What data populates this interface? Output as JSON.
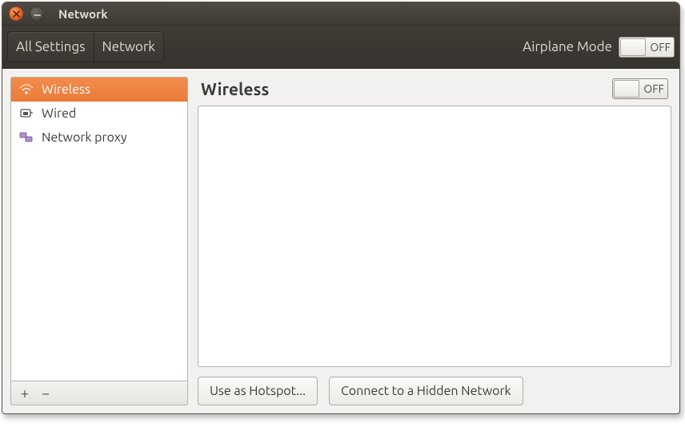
{
  "window": {
    "title": "Network"
  },
  "toolbar": {
    "all_settings": "All Settings",
    "network": "Network",
    "airplane_label": "Airplane Mode",
    "airplane_state": "OFF"
  },
  "sidebar": {
    "items": [
      {
        "label": "Wireless",
        "selected": true
      },
      {
        "label": "Wired"
      },
      {
        "label": "Network proxy"
      }
    ],
    "add": "+",
    "remove": "−"
  },
  "panel": {
    "title": "Wireless",
    "state": "OFF",
    "hotspot": "Use as Hotspot...",
    "hidden": "Connect to a Hidden Network"
  }
}
